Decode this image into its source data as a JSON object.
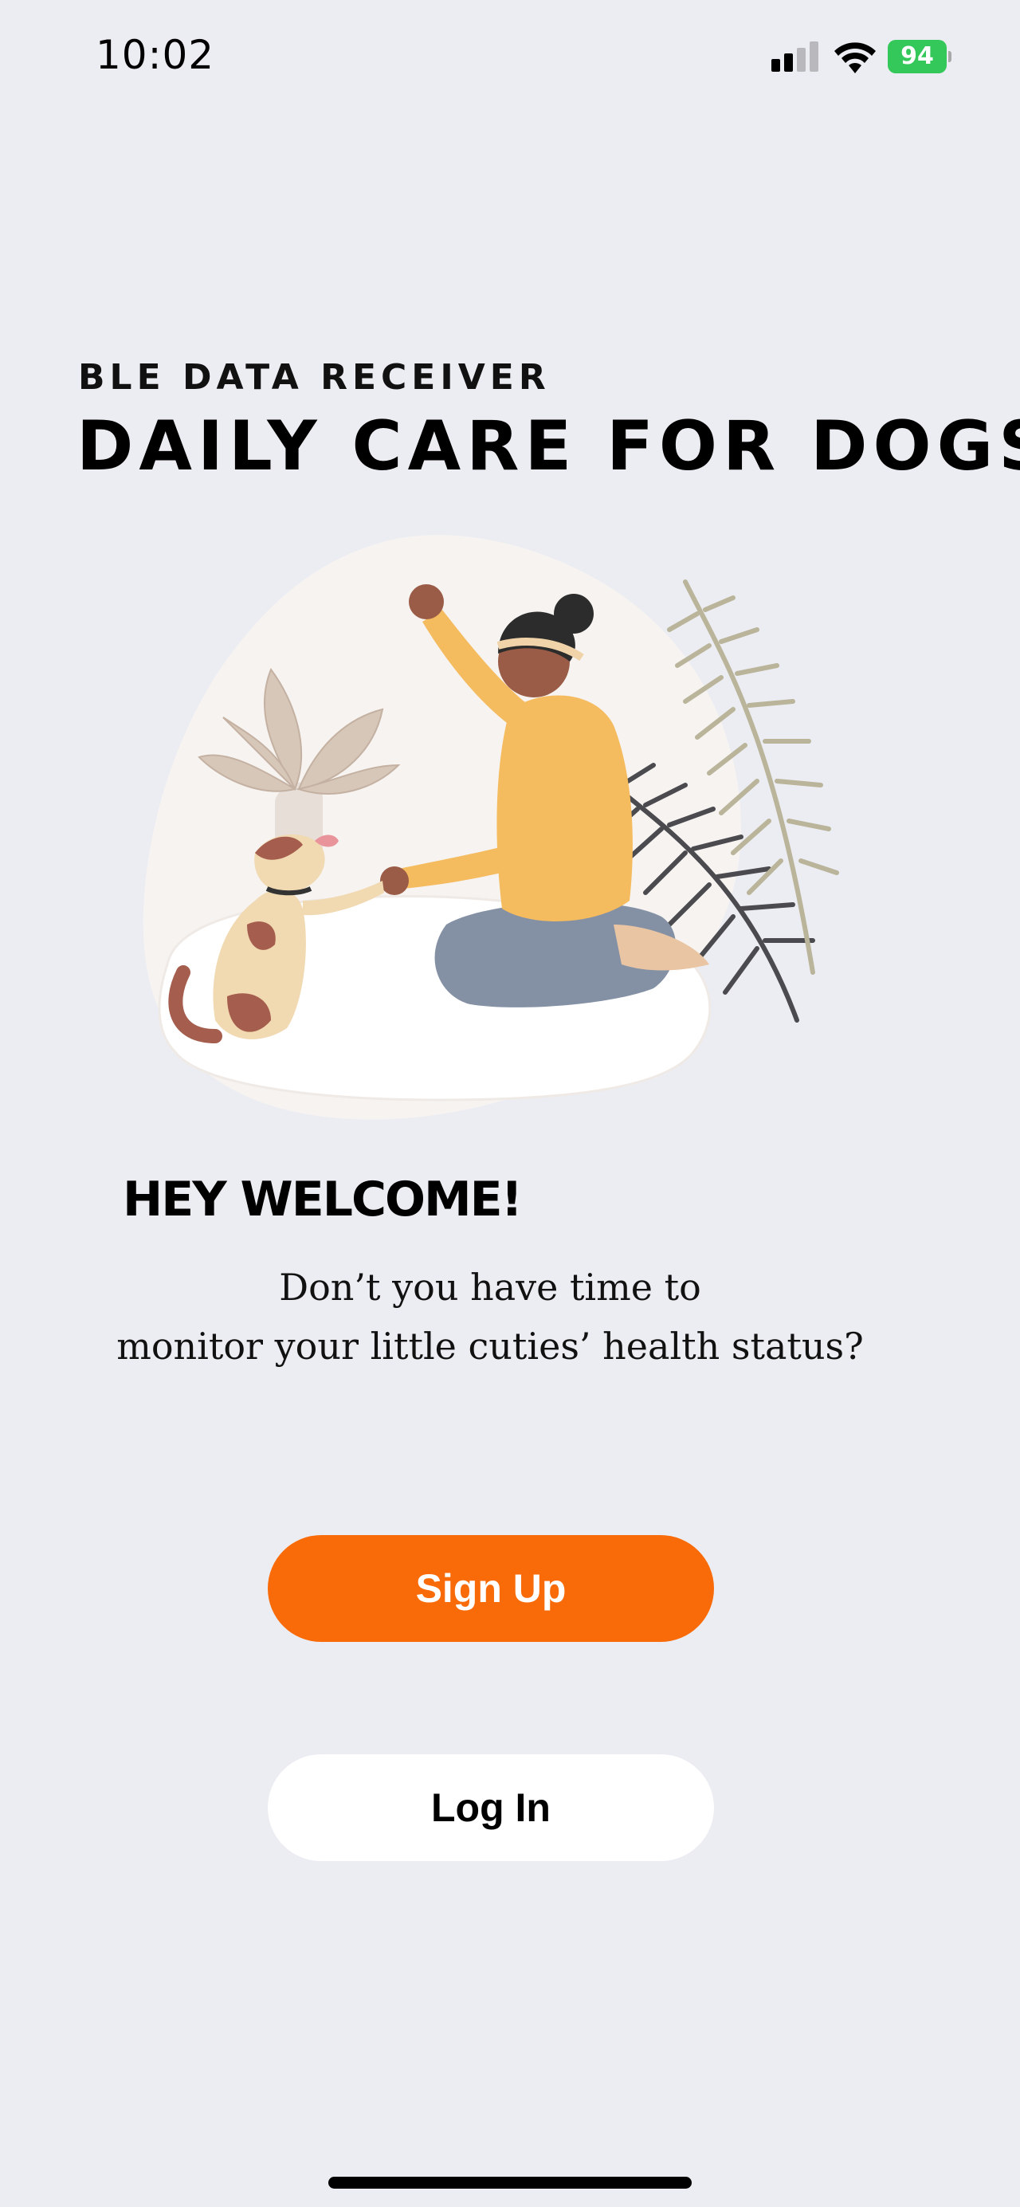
{
  "status_bar": {
    "time": "10:02",
    "battery_level": "94",
    "signal_icon": "cellular-signal-icon",
    "wifi_icon": "wifi-icon",
    "battery_color": "#34c759"
  },
  "header": {
    "subtitle": "BLE DATA RECEIVER",
    "title": "DAILY CARE FOR DOGS"
  },
  "illustration": {
    "icon": "woman-training-dog-illustration"
  },
  "welcome": {
    "heading": "HEY WELCOME!",
    "line1": "Don’t you have time to",
    "line2": "monitor your little cuties’ health status?"
  },
  "actions": {
    "signup_label": "Sign Up",
    "login_label": "Log In",
    "accent_color": "#f96a08"
  }
}
